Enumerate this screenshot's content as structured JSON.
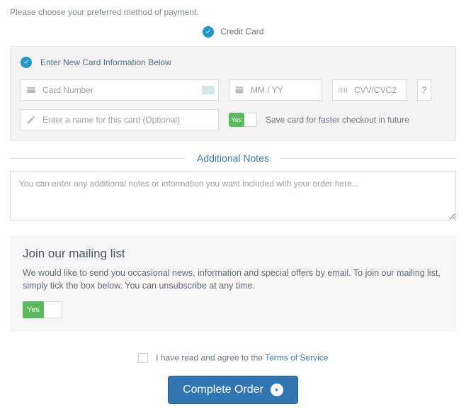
{
  "intro": "Please choose your preferred method of payment.",
  "payment_method": {
    "credit_card_label": "Credit Card"
  },
  "card_panel": {
    "title": "Enter New Card Information Below",
    "card_number": {
      "placeholder": "Card Number",
      "value": ""
    },
    "expiry": {
      "placeholder": "MM / YY",
      "value": ""
    },
    "cvv": {
      "placeholder": "CVV/CVC2",
      "value": ""
    },
    "help": "?",
    "name": {
      "placeholder": "Enter a name for this card (Optional)",
      "value": ""
    },
    "save_toggle": {
      "on_label": "Yes",
      "label": "Save card for faster checkout in future"
    }
  },
  "notes": {
    "heading": "Additional Notes",
    "placeholder": "You can enter any additional notes or information you want included with your order here...",
    "value": ""
  },
  "mailing": {
    "title": "Join our mailing list",
    "desc": "We would like to send you occasional news, information and special offers by email. To join our mailing list, simply tick the box below. You can unsubscribe at any time.",
    "toggle_on": "Yes"
  },
  "terms": {
    "text_prefix": "I have read and agree to the ",
    "link": "Terms of Service"
  },
  "submit": {
    "label": "Complete Order"
  }
}
